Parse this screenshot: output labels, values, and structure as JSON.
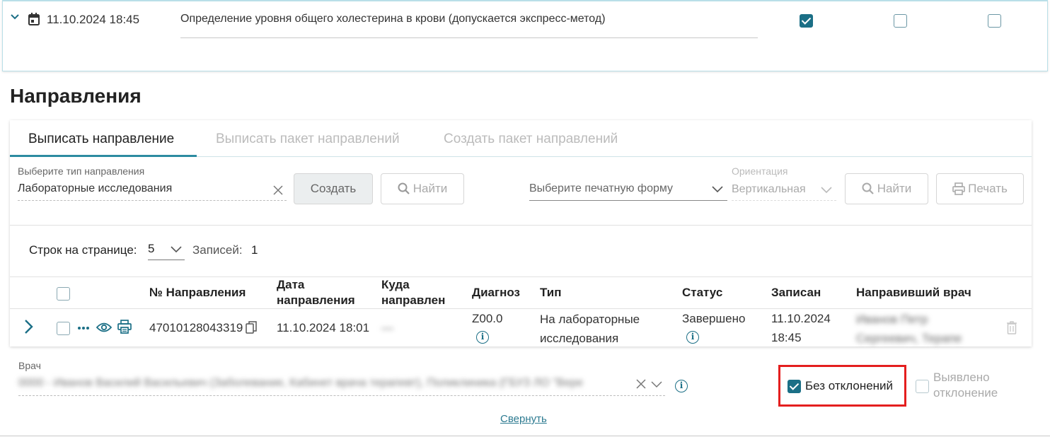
{
  "top_row": {
    "datetime": "11.10.2024 18:45",
    "service": "Определение уровня общего холестерина в крови (допускается экспресс-метод)",
    "checks": [
      true,
      false,
      false
    ]
  },
  "section_title": "Направления",
  "tabs": [
    "Выписать направление",
    "Выписать пакет направлений",
    "Создать пакет направлений"
  ],
  "filters": {
    "type_label": "Выберите тип направления",
    "type_value": "Лабораторные исследования",
    "create_button": "Создать",
    "find_button": "Найти",
    "print_form_placeholder": "Выберите печатную форму",
    "orientation_label": "Ориентация",
    "orientation_value": "Вертикальная",
    "find_button_2": "Найти",
    "print_button": "Печать"
  },
  "pagination": {
    "rows_label": "Строк на странице:",
    "rows_value": "5",
    "records_label": "Записей:",
    "records_value": "1"
  },
  "table": {
    "headers": {
      "number": "№ Направления",
      "date_line1": "Дата",
      "date_line2": "направления",
      "where_line1": "Куда",
      "where_line2": "направлен",
      "diagnosis": "Диагноз",
      "type": "Тип",
      "status": "Статус",
      "recorded": "Записан",
      "doctor": "Направивший врач"
    },
    "row": {
      "number": "47010128043319",
      "date": "11.10.2024 18:01",
      "where": "—",
      "diagnosis": "Z00.0",
      "type_line1": "На лабораторные",
      "type_line2": "исследования",
      "status": "Завершено",
      "recorded_line1": "11.10.2024",
      "recorded_line2": "18:45",
      "doctor_line1": "Иванов Петр",
      "doctor_line2": "Сергеевич, Терапе"
    }
  },
  "doctor_field": {
    "label": "Врач",
    "value": "0000 - Иванов Василий Васильевич (Заболевание, Кабинет врача терапевт), Поликлиника (ГБУЗ ЛО \"Вере"
  },
  "result_checks": {
    "normal_label": "Без отклонений",
    "normal_checked": true,
    "deviation_label_line1": "Выявлено",
    "deviation_label_line2": "отклонение",
    "deviation_checked": false
  },
  "collapse_link": "Свернуть",
  "colors": {
    "accent": "#1b6f86",
    "highlight": "#e41e1e"
  }
}
